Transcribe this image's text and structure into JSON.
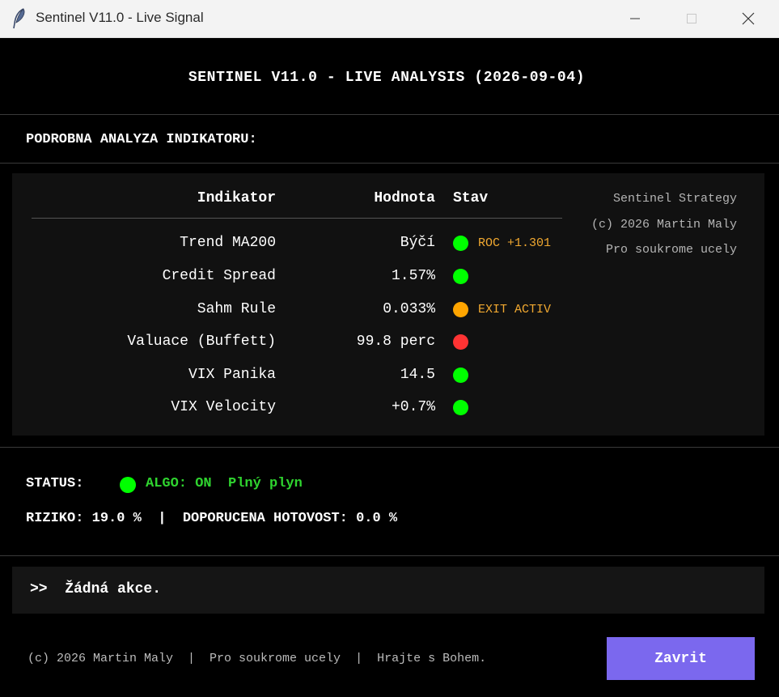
{
  "window": {
    "title": "Sentinel V11.0 - Live Signal"
  },
  "header": {
    "title": "SENTINEL V11.0 - LIVE ANALYSIS (2026-09-04)"
  },
  "section": {
    "title": "PODROBNA ANALYZA INDIKATORU:"
  },
  "table": {
    "headers": [
      "Indikator",
      "Hodnota",
      "Stav"
    ],
    "rows": [
      {
        "name": "Trend MA200",
        "value": "Býčí",
        "status_color": "#00ff00",
        "note": "ROC +1.301",
        "note_color": "#f0a830"
      },
      {
        "name": "Credit Spread",
        "value": "1.57%",
        "status_color": "#00ff00",
        "note": "",
        "note_color": ""
      },
      {
        "name": "Sahm Rule",
        "value": "0.033%",
        "status_color": "#ffa500",
        "note": "EXIT ACTIV",
        "note_color": "#f0a830"
      },
      {
        "name": "Valuace (Buffett)",
        "value": "99.8 perc",
        "status_color": "#ff3333",
        "note": "",
        "note_color": ""
      },
      {
        "name": "VIX Panika",
        "value": "14.5",
        "status_color": "#00ff00",
        "note": "",
        "note_color": ""
      },
      {
        "name": "VIX Velocity",
        "value": "+0.7%",
        "status_color": "#00ff00",
        "note": "",
        "note_color": ""
      }
    ]
  },
  "sidebar_info": {
    "line1": "Sentinel Strategy",
    "line2": "(c) 2026 Martin Maly",
    "line3": "Pro soukrome ucely"
  },
  "status": {
    "label": "STATUS:",
    "dot_color": "#00ff00",
    "text": "ALGO: ON  Plný plyn",
    "text_color": "#2fd42f"
  },
  "risk": {
    "text": "RIZIKO: 19.0 %  |  DOPORUCENA HOTOVOST: 0.0 %"
  },
  "action": {
    "text": ">>  Žádná akce."
  },
  "footer": {
    "text": "(c) 2026 Martin Maly  |  Pro soukrome ucely  |  Hrajte s Bohem.",
    "close_label": "Zavrit",
    "close_color": "#7b68ee"
  }
}
